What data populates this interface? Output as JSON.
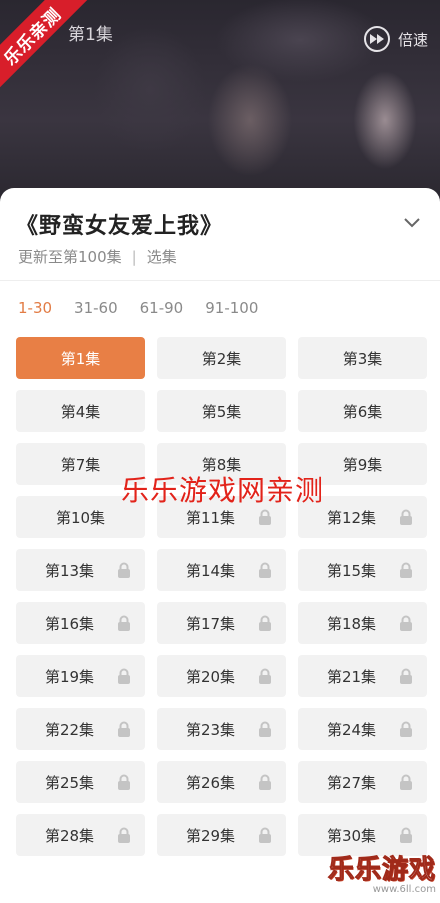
{
  "video": {
    "episode_title": "第1集",
    "speed_label": "倍速",
    "ribbon_text": "乐乐亲测"
  },
  "panel": {
    "title": "《野蛮女友爱上我》",
    "update_text": "更新至第100集",
    "separator": "|",
    "select_label": "选集"
  },
  "ranges": [
    {
      "label": "1-30",
      "active": true
    },
    {
      "label": "31-60",
      "active": false
    },
    {
      "label": "61-90",
      "active": false
    },
    {
      "label": "91-100",
      "active": false
    }
  ],
  "episodes": [
    {
      "label": "第1集",
      "active": true,
      "locked": false
    },
    {
      "label": "第2集",
      "active": false,
      "locked": false
    },
    {
      "label": "第3集",
      "active": false,
      "locked": false
    },
    {
      "label": "第4集",
      "active": false,
      "locked": false
    },
    {
      "label": "第5集",
      "active": false,
      "locked": false
    },
    {
      "label": "第6集",
      "active": false,
      "locked": false
    },
    {
      "label": "第7集",
      "active": false,
      "locked": false
    },
    {
      "label": "第8集",
      "active": false,
      "locked": false
    },
    {
      "label": "第9集",
      "active": false,
      "locked": false
    },
    {
      "label": "第10集",
      "active": false,
      "locked": false
    },
    {
      "label": "第11集",
      "active": false,
      "locked": true
    },
    {
      "label": "第12集",
      "active": false,
      "locked": true
    },
    {
      "label": "第13集",
      "active": false,
      "locked": true
    },
    {
      "label": "第14集",
      "active": false,
      "locked": true
    },
    {
      "label": "第15集",
      "active": false,
      "locked": true
    },
    {
      "label": "第16集",
      "active": false,
      "locked": true
    },
    {
      "label": "第17集",
      "active": false,
      "locked": true
    },
    {
      "label": "第18集",
      "active": false,
      "locked": true
    },
    {
      "label": "第19集",
      "active": false,
      "locked": true
    },
    {
      "label": "第20集",
      "active": false,
      "locked": true
    },
    {
      "label": "第21集",
      "active": false,
      "locked": true
    },
    {
      "label": "第22集",
      "active": false,
      "locked": true
    },
    {
      "label": "第23集",
      "active": false,
      "locked": true
    },
    {
      "label": "第24集",
      "active": false,
      "locked": true
    },
    {
      "label": "第25集",
      "active": false,
      "locked": true
    },
    {
      "label": "第26集",
      "active": false,
      "locked": true
    },
    {
      "label": "第27集",
      "active": false,
      "locked": true
    },
    {
      "label": "第28集",
      "active": false,
      "locked": true
    },
    {
      "label": "第29集",
      "active": false,
      "locked": true
    },
    {
      "label": "第30集",
      "active": false,
      "locked": true
    }
  ],
  "watermark": {
    "center_text": "乐乐游戏网亲测",
    "corner_text": "乐乐游戏",
    "corner_url": "www.6ll.com"
  },
  "colors": {
    "accent": "#e87f45",
    "watermark_red": "#e2231a",
    "ribbon_red": "#d81e2a"
  }
}
